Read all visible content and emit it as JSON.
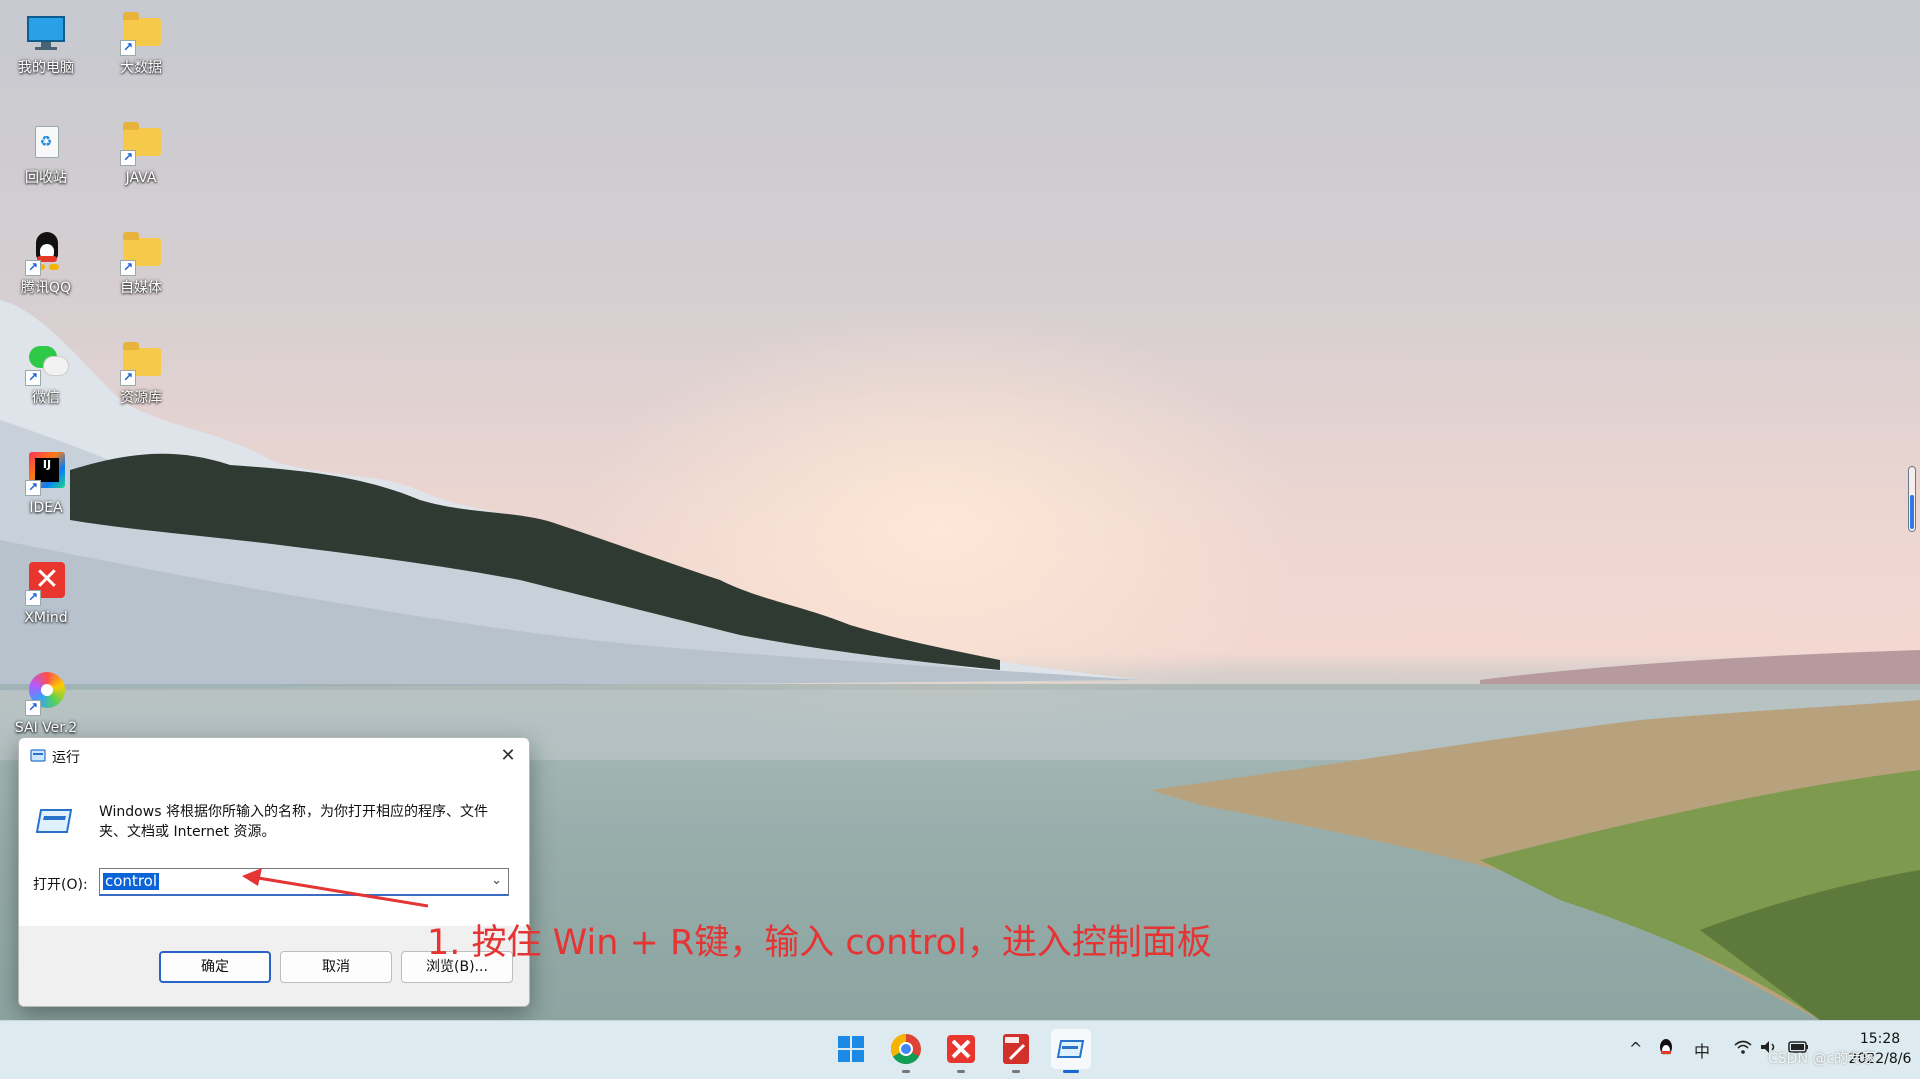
{
  "desktop": {
    "icons": [
      {
        "label": "我的电脑",
        "icon": "computer-icon"
      },
      {
        "label": "大数据",
        "icon": "folder-icon"
      },
      {
        "label": "回收站",
        "icon": "recycle-bin-icon"
      },
      {
        "label": "JAVA",
        "icon": "folder-icon"
      },
      {
        "label": "腾讯QQ",
        "icon": "qq-penguin-icon"
      },
      {
        "label": "自媒体",
        "icon": "folder-icon"
      },
      {
        "label": "微信",
        "icon": "wechat-icon"
      },
      {
        "label": "资源库",
        "icon": "folder-icon"
      },
      {
        "label": "IDEA",
        "icon": "intellij-idea-icon"
      },
      {
        "label": "XMind",
        "icon": "xmind-icon"
      },
      {
        "label": "SAI Ver.2",
        "icon": "sai-paint-icon"
      }
    ]
  },
  "run_dialog": {
    "title": "运行",
    "description": "Windows 将根据你所输入的名称，为你打开相应的程序、文件夹、文档或 Internet 资源。",
    "open_label": "打开(O):",
    "input_value": "control",
    "ok_label": "确定",
    "cancel_label": "取消",
    "browse_label": "浏览(B)..."
  },
  "annotation": {
    "text": "1. 按住 Win + R键，输入 control，进入控制面板",
    "color": "#e43434"
  },
  "taskbar": {
    "pinned": [
      "windows-start-icon",
      "chrome-icon",
      "xmind-icon",
      "pdf-editor-icon",
      "run-dialog-icon"
    ],
    "tray": {
      "ime": "中",
      "time": "15:28",
      "date": "2022/8/6"
    }
  },
  "watermark": "CSDN @c的专家"
}
